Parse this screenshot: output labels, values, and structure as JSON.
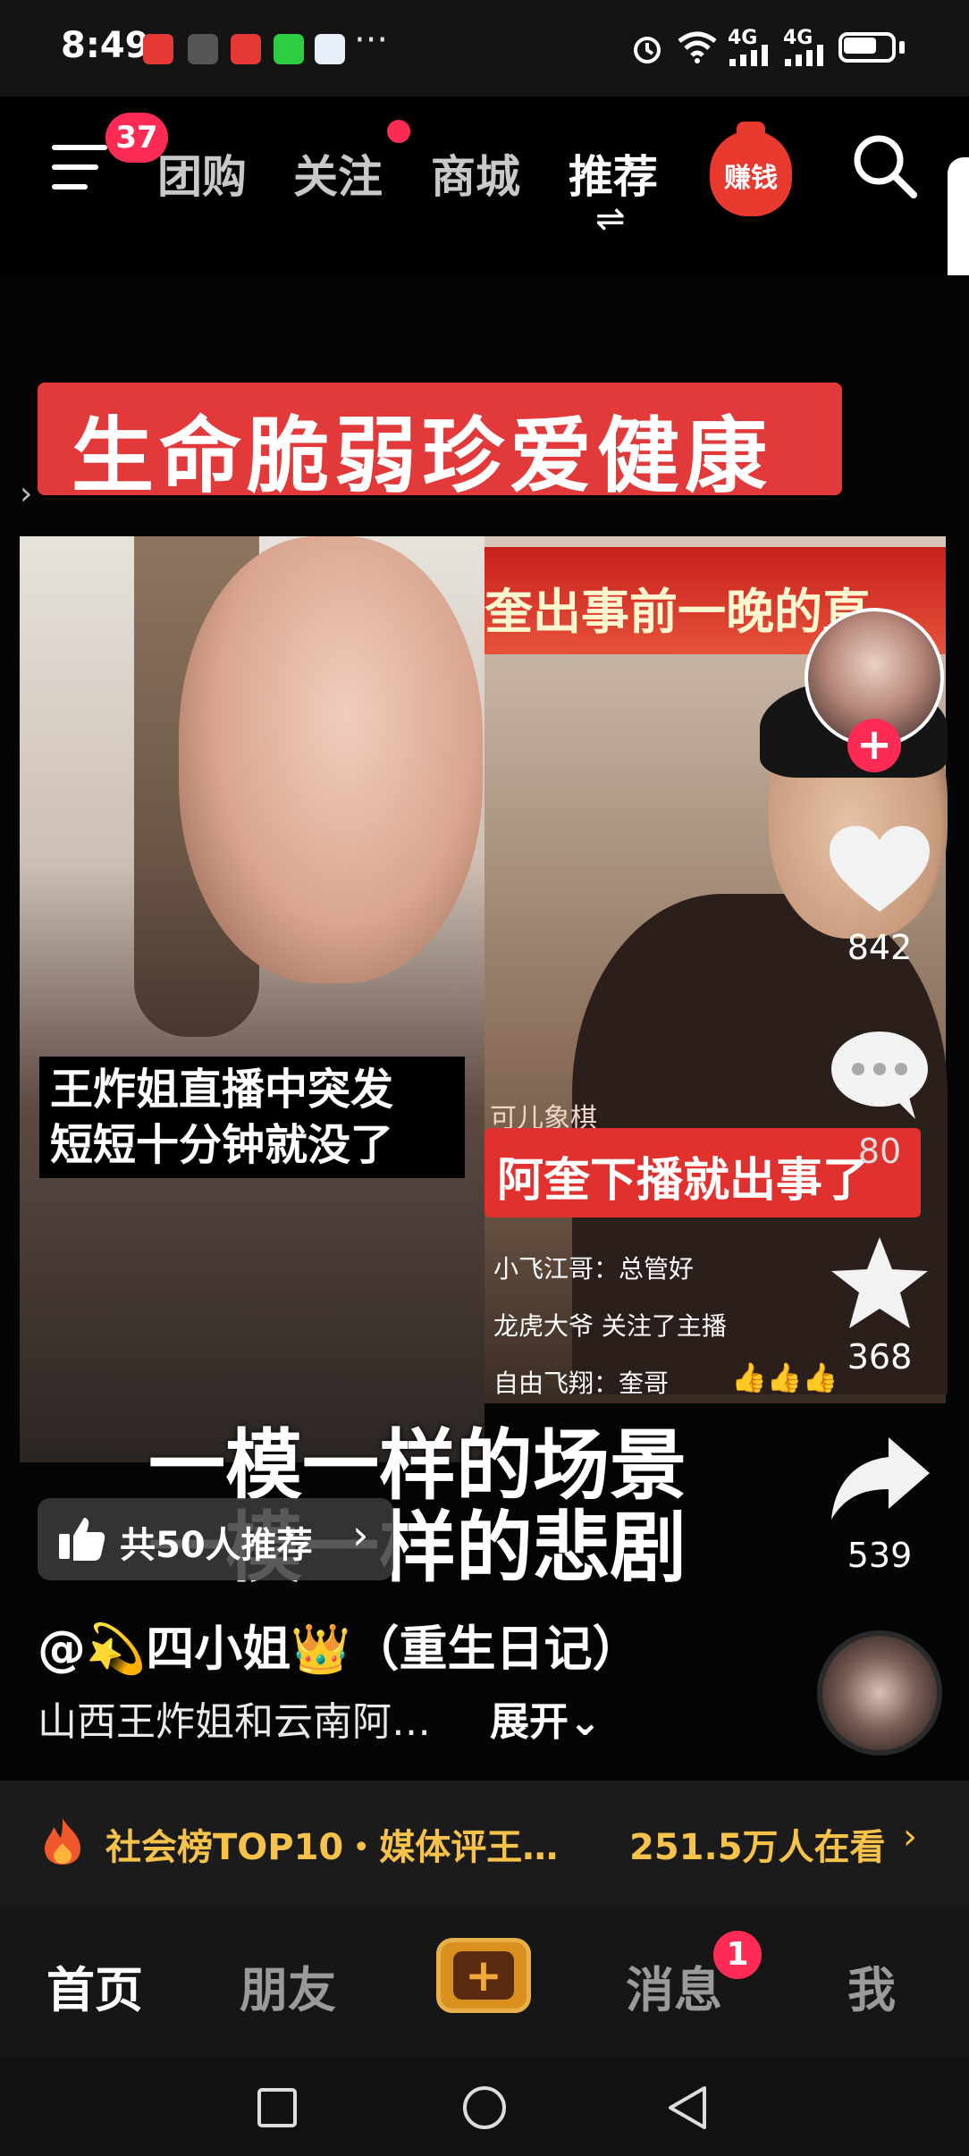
{
  "status_bar": {
    "time": "8:49",
    "more": "···",
    "network_1": "4G",
    "network_2": "4G"
  },
  "top_nav": {
    "menu_badge": "37",
    "tabs": [
      "团购",
      "关注",
      "商城",
      "推荐"
    ],
    "active_tab": "推荐",
    "switch_icon": "⇌",
    "earn_label": "赚钱"
  },
  "video": {
    "headline": "生命脆弱珍爱健康",
    "right_banner": "奎出事前一晚的直",
    "left_caption_1": "王炸姐直播中突发",
    "left_caption_2": "短短十分钟就没了",
    "small_label": "可儿象棋",
    "red_caption": "阿奎下播就出事了",
    "chat": [
      "小飞江哥：总管好",
      "龙虎大爷 关注了主播",
      "自由飞翔：奎哥"
    ],
    "thumbs": "👍👍👍",
    "overlay_line_1": "一模一样的场景",
    "overlay_line_2": "一模一样的悲剧"
  },
  "actions": {
    "likes": "842",
    "comments": "80",
    "favorites": "368",
    "shares": "539",
    "follow_plus": "+"
  },
  "info": {
    "recommend": "共50人推荐",
    "author": "@💫四小姐👑（重生日记）",
    "description": "山西王炸姐和云南阿…",
    "expand": "展开⌄"
  },
  "hot_bar": {
    "left": "社会榜TOP10・媒体评王…",
    "right": "251.5万人在看",
    "chevron": "›"
  },
  "bottom_nav": {
    "tabs": [
      "首页",
      "朋友",
      "消息",
      "我"
    ],
    "active_tab": "首页",
    "plus": "+",
    "message_badge": "1"
  },
  "colors": {
    "accent_red": "#fe2c55",
    "hot_yellow": "#f7c24a",
    "headline_red": "#e23a3a"
  }
}
